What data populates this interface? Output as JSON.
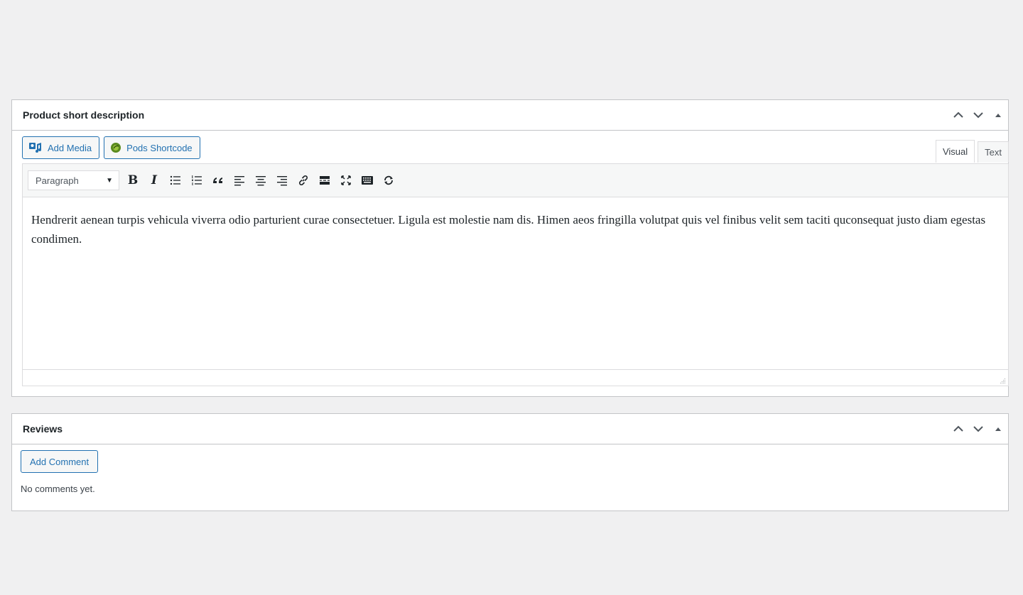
{
  "description_box": {
    "title": "Product short description",
    "media_buttons": {
      "add_media": "Add Media",
      "pods_shortcode": "Pods Shortcode"
    },
    "tabs": {
      "visual": "Visual",
      "text": "Text",
      "active": "Visual"
    },
    "toolbar": {
      "format_select": "Paragraph",
      "buttons": [
        "bold",
        "italic",
        "bulleted-list",
        "numbered-list",
        "blockquote",
        "align-left",
        "align-center",
        "align-right",
        "insert-link",
        "read-more",
        "fullscreen",
        "toolbar-toggle",
        "pods-refresh"
      ]
    },
    "content": "Hendrerit aenean turpis vehicula viverra odio parturient curae consectetuer. Ligula est molestie nam dis. Himen aeos fringilla volutpat quis vel finibus velit sem taciti quconsequat justo diam egestas condimen."
  },
  "reviews_box": {
    "title": "Reviews",
    "add_comment": "Add Comment",
    "empty_text": "No comments yet."
  },
  "colors": {
    "accent": "#2271b1",
    "background": "#f0f0f1",
    "border": "#c3c4c7"
  }
}
